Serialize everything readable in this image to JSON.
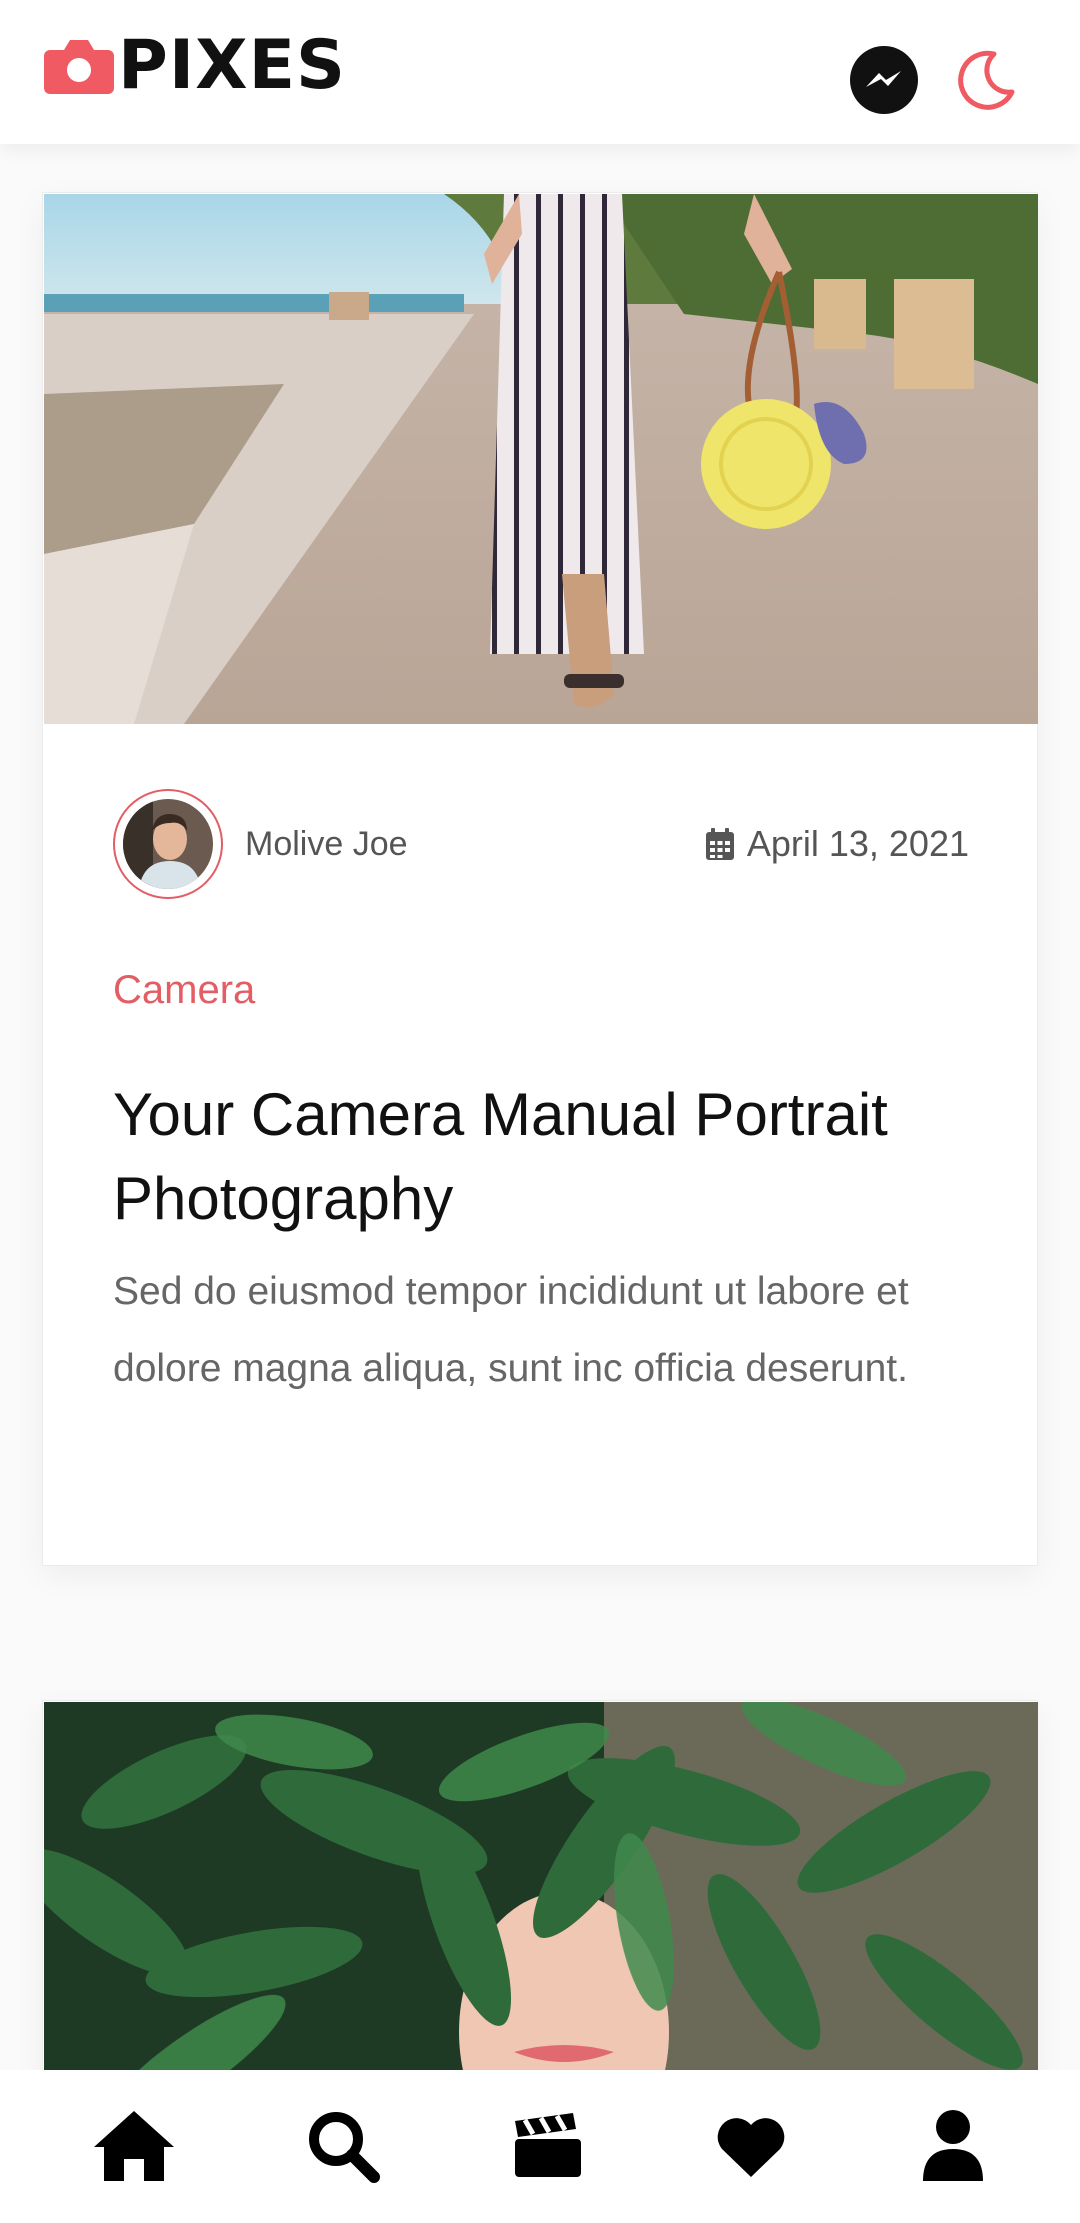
{
  "app": {
    "logo_text": "PIXES",
    "brand_color": "#f05a62"
  },
  "header": {
    "messenger_icon": "messenger-icon",
    "theme_icon": "moon-icon"
  },
  "posts": [
    {
      "image": "woman-striped-dress-yellow-bag",
      "author": "Molive Joe",
      "date": "April 13, 2021",
      "category": "Camera",
      "title": "Your Camera Manual Portrait Photography",
      "excerpt": "Sed do eiusmod tempor incididunt ut labore et dolore magna aliqua, sunt inc officia deserunt."
    },
    {
      "image": "woman-behind-leaves"
    }
  ],
  "bottom_nav": [
    {
      "icon": "home-icon"
    },
    {
      "icon": "search-icon"
    },
    {
      "icon": "clapperboard-icon"
    },
    {
      "icon": "heart-icon"
    },
    {
      "icon": "user-icon"
    }
  ],
  "colors": {
    "accent": "#e25d64",
    "text": "#111111",
    "muted": "#666666"
  }
}
